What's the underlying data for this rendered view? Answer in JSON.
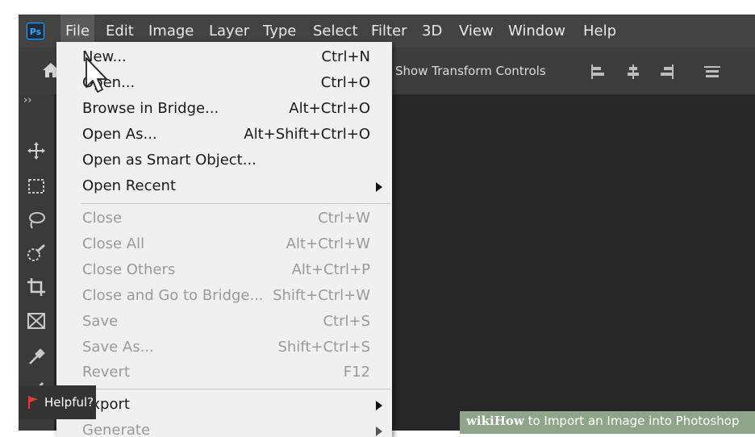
{
  "app_logo": "Ps",
  "menubar": [
    "File",
    "Edit",
    "Image",
    "Layer",
    "Type",
    "Select",
    "Filter",
    "3D",
    "View",
    "Window",
    "Help"
  ],
  "options_bar": {
    "show_transform_label": "Show Transform Controls"
  },
  "toolbar": {
    "collapse": "››"
  },
  "file_menu": [
    {
      "label": "New...",
      "shortcut": "Ctrl+N",
      "enabled": true
    },
    {
      "label": "Open...",
      "shortcut": "Ctrl+O",
      "enabled": true
    },
    {
      "label": "Browse in Bridge...",
      "shortcut": "Alt+Ctrl+O",
      "enabled": true
    },
    {
      "label": "Open As...",
      "shortcut": "Alt+Shift+Ctrl+O",
      "enabled": true
    },
    {
      "label": "Open as Smart Object...",
      "shortcut": "",
      "enabled": true
    },
    {
      "label": "Open Recent",
      "shortcut": "",
      "enabled": true,
      "submenu": true
    },
    {
      "label": "Close",
      "shortcut": "Ctrl+W",
      "enabled": false
    },
    {
      "label": "Close All",
      "shortcut": "Alt+Ctrl+W",
      "enabled": false
    },
    {
      "label": "Close Others",
      "shortcut": "Alt+Ctrl+P",
      "enabled": false
    },
    {
      "label": "Close and Go to Bridge...",
      "shortcut": "Shift+Ctrl+W",
      "enabled": false
    },
    {
      "label": "Save",
      "shortcut": "Ctrl+S",
      "enabled": false
    },
    {
      "label": "Save As...",
      "shortcut": "Shift+Ctrl+S",
      "enabled": false
    },
    {
      "label": "Revert",
      "shortcut": "F12",
      "enabled": false
    },
    {
      "label": "Export",
      "shortcut": "",
      "enabled": true,
      "submenu": true
    },
    {
      "label": "Generate",
      "shortcut": "",
      "enabled": false,
      "submenu": true
    }
  ],
  "helpful_badge": "Helpful?",
  "watermark": {
    "brand": "wikiHow",
    "caption": " to Import an Image into Photoshop"
  },
  "colors": {
    "menubar": "#434343",
    "dropdown": "#f0f0f0",
    "accent": "#31a8ff"
  }
}
